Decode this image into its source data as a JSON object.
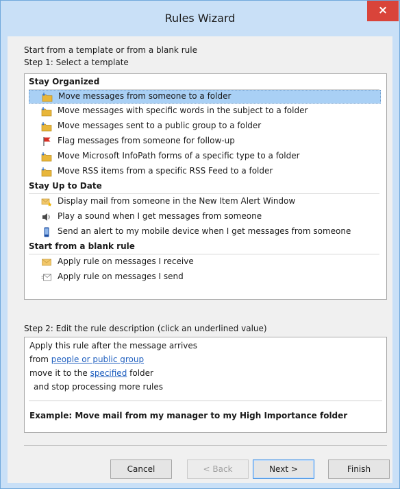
{
  "window": {
    "title": "Rules Wizard",
    "close_glyph": "×"
  },
  "intro": "Start from a template or from a blank rule",
  "step1_label": "Step 1: Select a template",
  "groups": [
    {
      "header": "Stay Organized",
      "items": [
        {
          "label": "Move messages from someone to a folder",
          "icon": "folder-arrow-icon",
          "selected": true
        },
        {
          "label": "Move messages with specific words in the subject to a folder",
          "icon": "folder-arrow-icon"
        },
        {
          "label": "Move messages sent to a public group to a folder",
          "icon": "folder-arrow-icon"
        },
        {
          "label": "Flag messages from someone for follow-up",
          "icon": "red-flag-icon"
        },
        {
          "label": "Move Microsoft InfoPath forms of a specific type to a folder",
          "icon": "folder-arrow-icon"
        },
        {
          "label": "Move RSS items from a specific RSS Feed to a folder",
          "icon": "folder-arrow-icon"
        }
      ]
    },
    {
      "header": "Stay Up to Date",
      "items": [
        {
          "label": "Display mail from someone in the New Item Alert Window",
          "icon": "envelope-star-icon"
        },
        {
          "label": "Play a sound when I get messages from someone",
          "icon": "speaker-icon"
        },
        {
          "label": "Send an alert to my mobile device when I get messages from someone",
          "icon": "mobile-device-icon"
        }
      ]
    },
    {
      "header": "Start from a blank rule",
      "items": [
        {
          "label": "Apply rule on messages I receive",
          "icon": "envelope-icon"
        },
        {
          "label": "Apply rule on messages I send",
          "icon": "send-mail-icon"
        }
      ]
    }
  ],
  "step2_label": "Step 2: Edit the rule description (click an underlined value)",
  "description": {
    "line1": "Apply this rule after the message arrives",
    "line2_prefix": "from ",
    "line2_link": "people or public group",
    "line3_prefix": "move it to the ",
    "line3_link": "specified",
    "line3_suffix": " folder",
    "line4": "and stop processing more rules",
    "example": "Example: Move mail from my manager to my High Importance folder"
  },
  "buttons": {
    "cancel": "Cancel",
    "back": "< Back",
    "next": "Next >",
    "finish": "Finish"
  },
  "colors": {
    "titlebar": "#c9e0f7",
    "close_button": "#d9443a",
    "selection": "#a9d0f5",
    "link": "#1f5fbf"
  }
}
